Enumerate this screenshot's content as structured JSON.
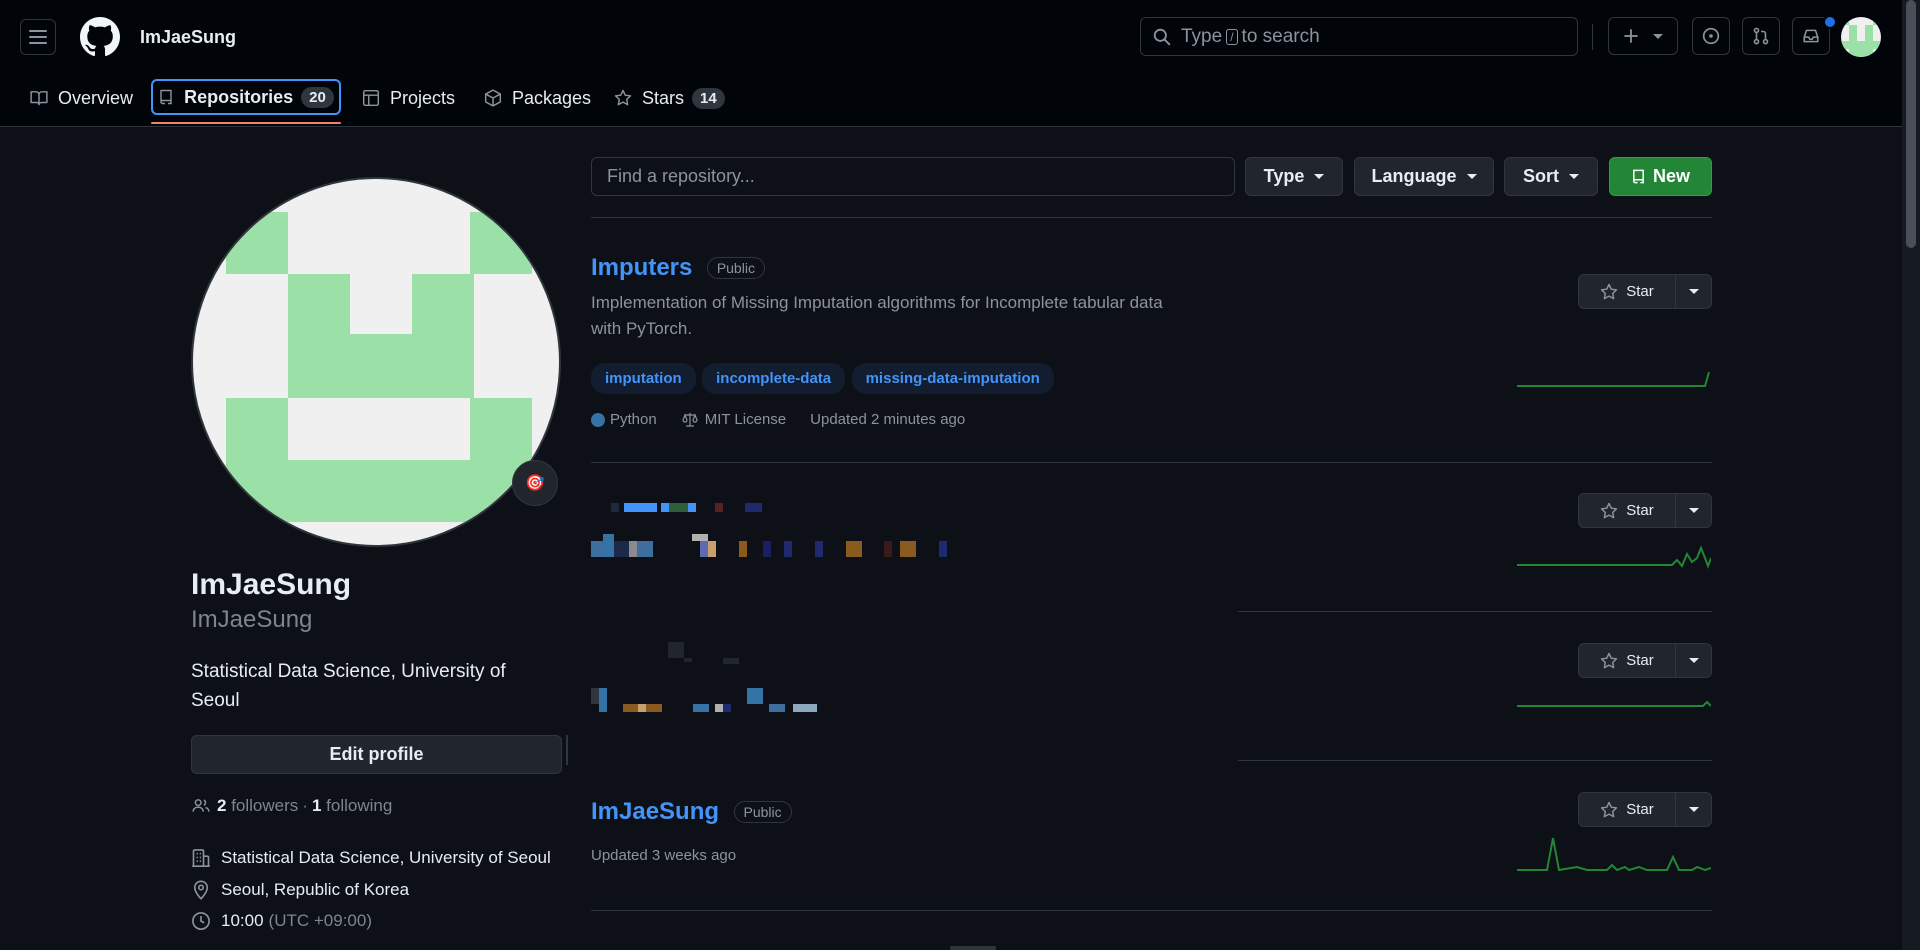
{
  "header": {
    "username": "ImJaeSung",
    "search_placeholder": "Type / to search",
    "search_before": "Type",
    "search_key": "/",
    "search_after": "to search"
  },
  "nav": {
    "tabs": [
      {
        "label": "Overview"
      },
      {
        "label": "Repositories",
        "count": "20"
      },
      {
        "label": "Projects"
      },
      {
        "label": "Packages"
      },
      {
        "label": "Stars",
        "count": "14"
      }
    ]
  },
  "profile": {
    "display_name": "ImJaeSung",
    "username": "ImJaeSung",
    "bio": "Statistical Data Science, University of Seoul",
    "edit_button": "Edit profile",
    "followers_count": "2",
    "followers_label": "followers",
    "following_count": "1",
    "following_label": "following",
    "separator": "·",
    "organization": "Statistical Data Science, University of Seoul",
    "location": "Seoul, Republic of Korea",
    "local_time": "10:00",
    "timezone": "(UTC +09:00)",
    "status_emoji": "🎯"
  },
  "filters": {
    "find_placeholder": "Find a repository...",
    "type_label": "Type",
    "language_label": "Language",
    "sort_label": "Sort",
    "new_label": "New"
  },
  "repos": [
    {
      "name": "Imputers",
      "visibility": "Public",
      "description": "Implementation of Missing Imputation algorithms for Incomplete tabular data with PyTorch.",
      "topics": [
        "imputation",
        "incomplete-data",
        "missing-data-imputation"
      ],
      "language": "Python",
      "language_color": "#3572A5",
      "license": "MIT License",
      "updated": "Updated 2 minutes ago",
      "star_label": "Star"
    },
    {
      "star_label": "Star"
    },
    {
      "star_label": "Star"
    },
    {
      "name": "ImJaeSung",
      "visibility": "Public",
      "updated": "Updated 3 weeks ago",
      "star_label": "Star"
    }
  ],
  "colors": {
    "accent": "#4493f8",
    "new_button": "#238636",
    "sparkline": "#238636",
    "avatar_green": "#9be0a7",
    "avatar_bg": "#f0f0f0",
    "active_tab_underline": "#f78166"
  }
}
